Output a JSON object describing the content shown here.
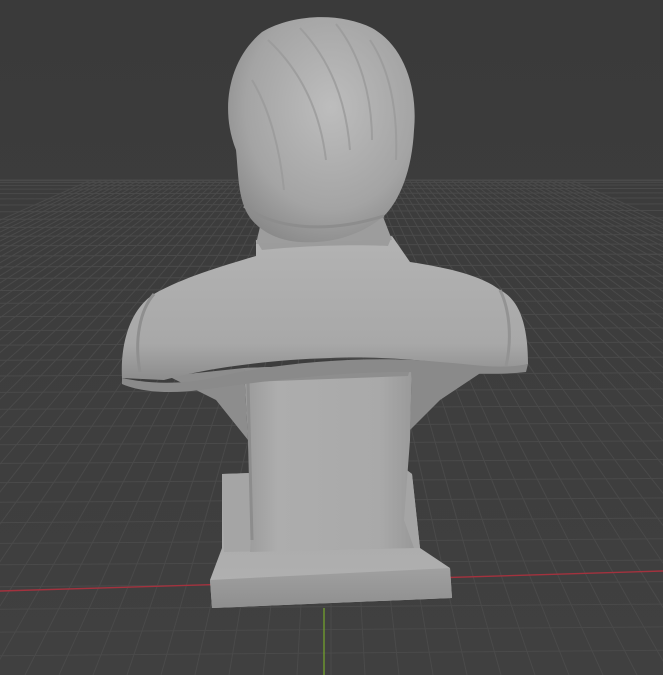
{
  "viewport": {
    "background_color": "#3d3d3d",
    "grid_color": "#4a4a4a",
    "x_axis_color": "#a3323e",
    "y_axis_color": "#6f9a2e",
    "model_color": "#a9a9a9"
  },
  "scene": {
    "object": "bust-model",
    "view": "back",
    "grid_floor": true
  }
}
